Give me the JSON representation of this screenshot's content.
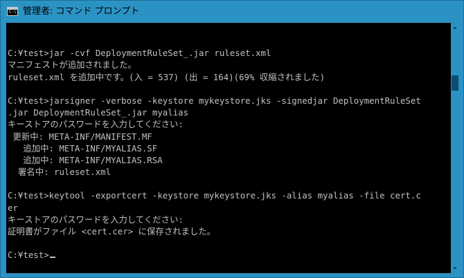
{
  "window": {
    "title": "管理者: コマンド プロンプト",
    "icon": "C:\\",
    "accent_color": "#2b93c4"
  },
  "console": {
    "lines": [
      "",
      "C:¥test>jar -cvf DeploymentRuleSet_.jar ruleset.xml",
      "マニフェストが追加されました。",
      "ruleset.xml を追加中です。(入 = 537) (出 = 164)(69% 収縮されました)",
      "",
      "C:¥test>jarsigner -verbose -keystore mykeystore.jks -signedjar DeploymentRuleSet",
      ".jar DeploymentRuleSet_.jar myalias",
      "キーストアのパスワードを入力してください:",
      " 更新中: META-INF/MANIFEST.MF",
      "   追加中: META-INF/MYALIAS.SF",
      "   追加中: META-INF/MYALIAS.RSA",
      "  署名中: ruleset.xml",
      "",
      "C:¥test>keytool -exportcert -keystore mykeystore.jks -alias myalias -file cert.c",
      "er",
      "キーストアのパスワードを入力してください:",
      "証明書がファイル <cert.cer> に保存されました。",
      "",
      "C:¥test>"
    ],
    "text_color": "#c0c0c0",
    "background": "#000000"
  },
  "scrollbar": {
    "icon_up": "arrow-up-icon",
    "icon_down": "arrow-down-icon"
  }
}
